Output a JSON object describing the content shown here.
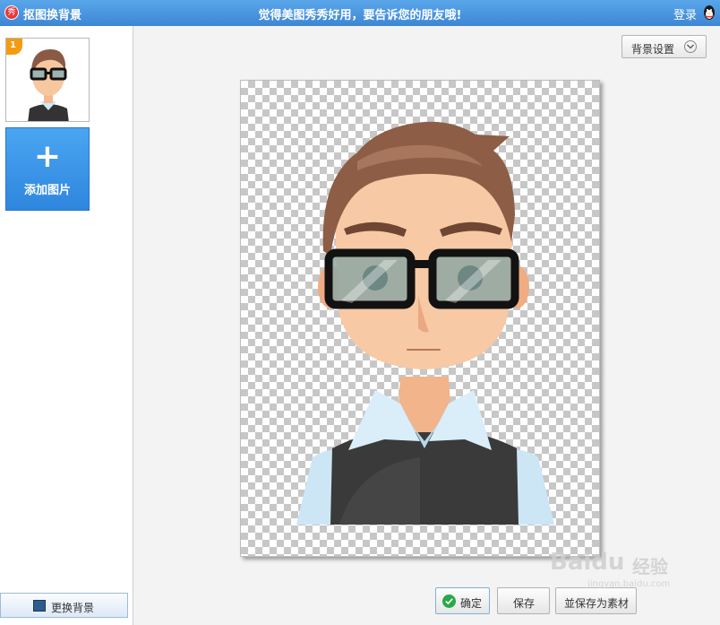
{
  "titlebar": {
    "logo_glyph": "秀",
    "app_title": "抠图换背景",
    "slogan": "觉得美图秀秀好用，要告诉您的朋友哦!",
    "login_label": "登录"
  },
  "sidebar": {
    "thumbnail_badge": "1",
    "add_plus": "+",
    "add_label": "添加图片",
    "change_bg_label": "更换背景"
  },
  "main": {
    "bg_settings_label": "背景设置",
    "confirm_label": "确定",
    "save_label": "保存",
    "save_material_label": "並保存为素材"
  },
  "watermark": {
    "brand": "Baidu",
    "suffix": "经验",
    "url": "jingyan.baidu.com"
  },
  "colors": {
    "titlebar": "#3c86d4",
    "add_button": "#3a94e8",
    "confirm_check": "#29a84a"
  }
}
